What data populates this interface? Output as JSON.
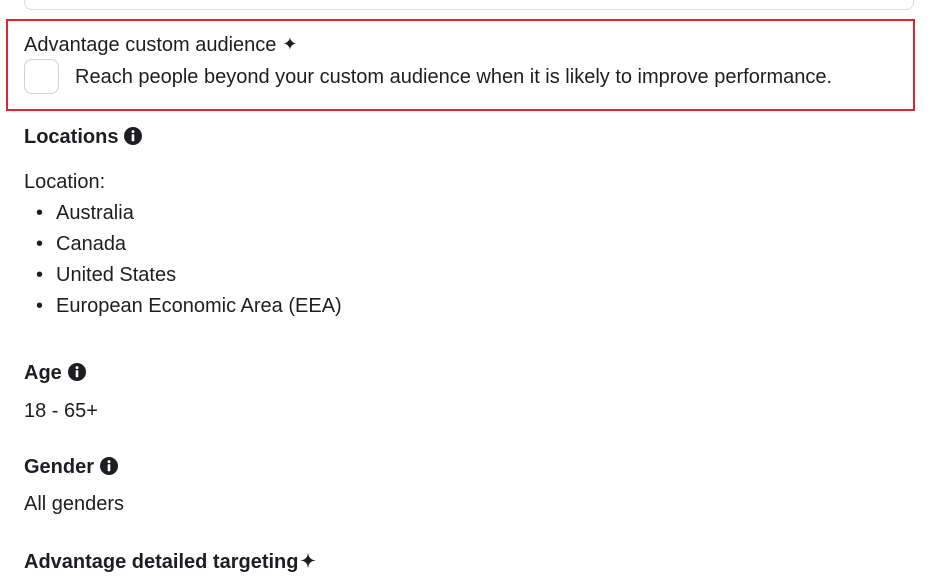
{
  "advantage_custom_audience": {
    "title": "Advantage custom audience",
    "checkbox_label": "Reach people beyond your custom audience when it is likely to improve performance."
  },
  "locations": {
    "heading": "Locations",
    "label": "Location:",
    "items": [
      "Australia",
      "Canada",
      "United States",
      "European Economic Area (EEA)"
    ]
  },
  "age": {
    "heading": "Age",
    "value": "18 - 65+"
  },
  "gender": {
    "heading": "Gender",
    "value": "All genders"
  },
  "advantage_detailed_targeting": {
    "heading": "Advantage detailed targeting"
  },
  "icons": {
    "sparkle": "sparkle-icon",
    "info": "info-icon"
  },
  "colors": {
    "highlight": "#e0242b",
    "text": "#1c1e21"
  }
}
